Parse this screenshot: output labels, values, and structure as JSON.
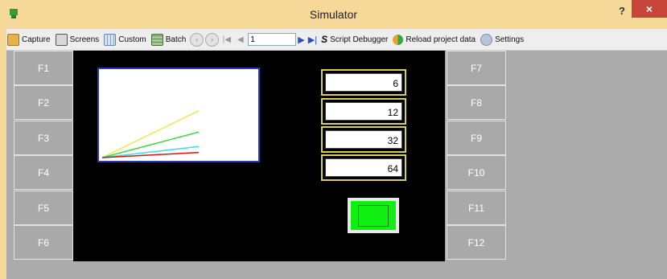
{
  "window": {
    "title": "Simulator",
    "help_label": "?",
    "close_label": "×"
  },
  "toolbar": {
    "capture": "Capture",
    "screens": "Screens",
    "custom": "Custom",
    "batch": "Batch",
    "page_value": "1",
    "script_debugger": "Script Debugger",
    "reload": "Reload project data",
    "settings": "Settings"
  },
  "fkeys_left": [
    "F1",
    "F2",
    "F3",
    "F4",
    "F5",
    "F6"
  ],
  "fkeys_right": [
    "F7",
    "F8",
    "F9",
    "F10",
    "F11",
    "F12"
  ],
  "numeric_displays": [
    "6",
    "12",
    "32",
    "64"
  ],
  "trend_lines": [
    {
      "color": "#f2e84a",
      "end": 0.55
    },
    {
      "color": "#33dd33",
      "end": 0.3
    },
    {
      "color": "#33e0e8",
      "end": 0.13
    },
    {
      "color": "#dd1111",
      "end": 0.06
    }
  ],
  "lamp": {
    "color": "#11ee11",
    "state": "on"
  }
}
